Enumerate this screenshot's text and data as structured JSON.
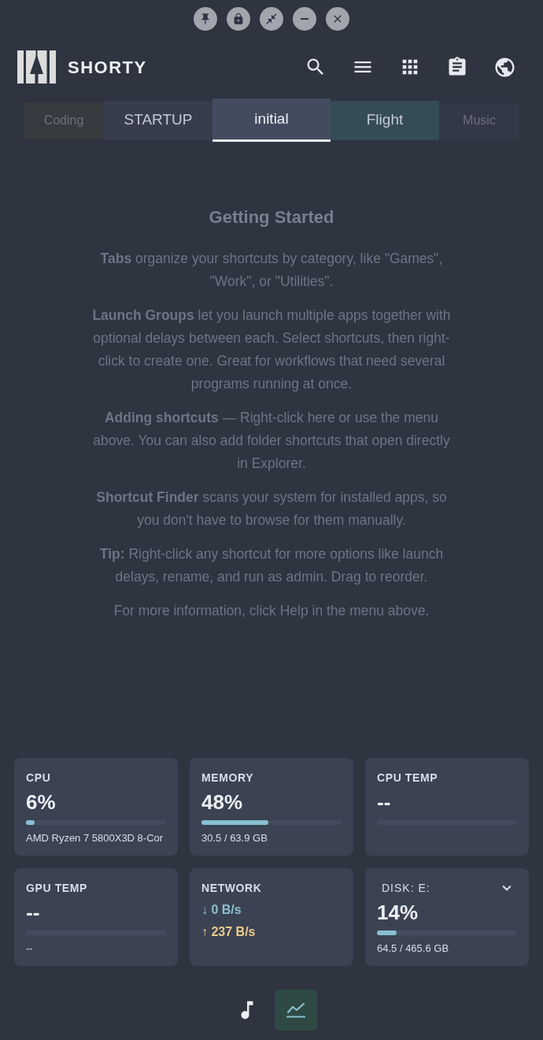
{
  "app": {
    "title": "SHORTY"
  },
  "tabs": [
    {
      "label": "Coding",
      "selected": false,
      "dimmed": true,
      "color": "#363b3f"
    },
    {
      "label": "STARTUP",
      "selected": false,
      "dimmed": false,
      "color": "#373d4b"
    },
    {
      "label": "initial",
      "selected": true,
      "dimmed": false,
      "color": "#434b5e"
    },
    {
      "label": "Flight",
      "selected": false,
      "dimmed": false,
      "color": "#354c57"
    },
    {
      "label": "Music",
      "selected": false,
      "dimmed": true,
      "color": "#323848"
    }
  ],
  "getting_started": {
    "title": "Getting Started",
    "paragraphs": [
      "**Tabs** organize your shortcuts by category, like \"Games\", \"Work\", or \"Utilities\".",
      "**Launch Groups** let you launch multiple apps together with optional delays between each. Select shortcuts, then right-click to create one. Great for workflows that need several programs running at once.",
      "**Adding shortcuts** — Right-click here or use the menu above. You can also add folder shortcuts that open directly in Explorer.",
      "**Shortcut Finder** scans your system for installed apps, so you don't have to browse for them manually.",
      "**Tip:** Right-click any shortcut for more options like launch delays, rename, and run as admin. Drag to reorder.",
      "For more information, click Help in the menu above."
    ]
  },
  "stats": [
    {
      "kind": "meter",
      "label": "CPU",
      "value": "6%",
      "level": 0.06,
      "detail": "AMD Ryzen 7 5800X3D 8-Cor"
    },
    {
      "kind": "meter",
      "label": "MEMORY",
      "value": "48%",
      "level": 0.48,
      "detail": "30.5 / 63.9 GB"
    },
    {
      "kind": "meter",
      "label": "CPU TEMP",
      "value": "--"
    },
    {
      "kind": "meter",
      "label": "GPU TEMP",
      "value": "--",
      "detail": "--"
    },
    {
      "kind": "network",
      "label": "NETWORK",
      "download": "↓ 0 B/s",
      "upload": "↑ 237 B/s"
    },
    {
      "kind": "select_meter",
      "label": "DISK: E:",
      "value": "14%",
      "level": 0.14,
      "detail": "64.5 / 465.6 GB"
    }
  ],
  "view_switcher": [
    {
      "kind": "music",
      "selected": false
    },
    {
      "kind": "chart",
      "selected": true
    }
  ]
}
